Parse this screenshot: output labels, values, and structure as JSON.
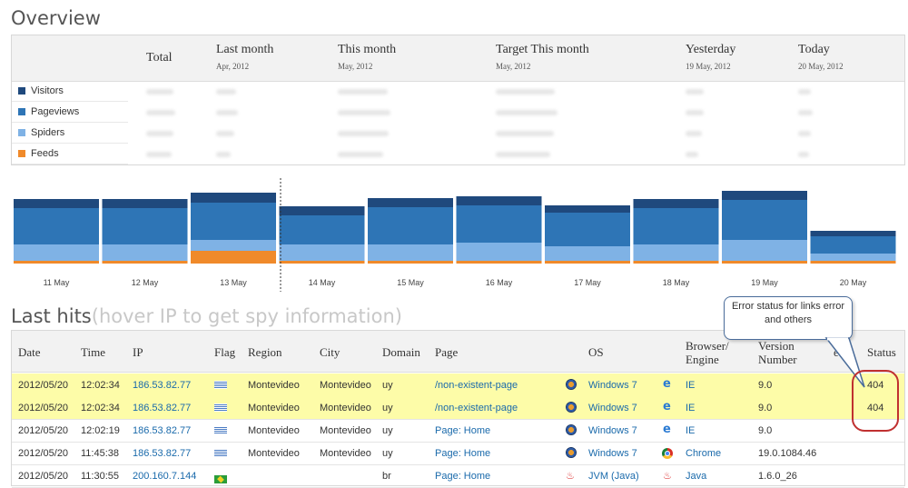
{
  "overview": {
    "title": "Overview",
    "columns": [
      {
        "label": "Total",
        "sub": ""
      },
      {
        "label": "Last month",
        "sub": "Apr, 2012"
      },
      {
        "label": "This month",
        "sub": "May, 2012"
      },
      {
        "label": "Target This month",
        "sub": "May, 2012"
      },
      {
        "label": "Yesterday",
        "sub": "19 May, 2012"
      },
      {
        "label": "Today",
        "sub": "20 May, 2012"
      }
    ],
    "rows": [
      {
        "label": "Visitors",
        "color": "#1f497d"
      },
      {
        "label": "Pageviews",
        "color": "#2e75b6"
      },
      {
        "label": "Spiders",
        "color": "#7fb2e5"
      },
      {
        "label": "Feeds",
        "color": "#f08a2a"
      }
    ]
  },
  "chart_data": {
    "type": "bar",
    "categories": [
      "11 May",
      "12 May",
      "13 May",
      "14 May",
      "15 May",
      "16 May",
      "17 May",
      "18 May",
      "19 May",
      "20 May"
    ],
    "series": [
      {
        "name": "Feeds",
        "values": [
          3,
          3,
          14,
          3,
          3,
          3,
          3,
          3,
          3,
          3
        ]
      },
      {
        "name": "Spiders",
        "values": [
          18,
          18,
          12,
          18,
          18,
          20,
          16,
          18,
          23,
          8
        ]
      },
      {
        "name": "Pageviews",
        "values": [
          40,
          40,
          41,
          32,
          41,
          41,
          37,
          40,
          44,
          19
        ]
      },
      {
        "name": "Visitors",
        "values": [
          10,
          10,
          11,
          10,
          10,
          10,
          8,
          10,
          10,
          6
        ]
      }
    ],
    "colors": [
      "#f08a2a",
      "#7fb2e5",
      "#2e75b6",
      "#1f497d"
    ],
    "title": "",
    "xlabel": "",
    "ylabel": ""
  },
  "hits": {
    "title": "Last hits",
    "hint": "(hover IP to get spy information)",
    "headers": [
      "Date",
      "Time",
      "IP",
      "Flag",
      "Region",
      "City",
      "Domain",
      "Page",
      "OS",
      "Browser/\nEngine",
      "Version\nNumber",
      "eed",
      "Status"
    ],
    "rows": [
      {
        "date": "2012/05/20",
        "time": "12:02:34",
        "ip": "186.53.82.77",
        "flag": "uy",
        "region": "Montevideo",
        "city": "Montevideo",
        "domain": "uy",
        "page": "/non-existent-page",
        "os_icon": "windows-icon",
        "os": "Windows 7",
        "browser_icon": "ie-icon",
        "browser": "IE",
        "version": "9.0",
        "status": "404",
        "highlight": true
      },
      {
        "date": "2012/05/20",
        "time": "12:02:34",
        "ip": "186.53.82.77",
        "flag": "uy",
        "region": "Montevideo",
        "city": "Montevideo",
        "domain": "uy",
        "page": "/non-existent-page",
        "os_icon": "windows-icon",
        "os": "Windows 7",
        "browser_icon": "ie-icon",
        "browser": "IE",
        "version": "9.0",
        "status": "404",
        "highlight": true
      },
      {
        "date": "2012/05/20",
        "time": "12:02:19",
        "ip": "186.53.82.77",
        "flag": "uy",
        "region": "Montevideo",
        "city": "Montevideo",
        "domain": "uy",
        "page": "Page: Home",
        "os_icon": "windows-icon",
        "os": "Windows 7",
        "browser_icon": "ie-icon",
        "browser": "IE",
        "version": "9.0",
        "status": "",
        "highlight": false
      },
      {
        "date": "2012/05/20",
        "time": "11:45:38",
        "ip": "186.53.82.77",
        "flag": "uy",
        "region": "Montevideo",
        "city": "Montevideo",
        "domain": "uy",
        "page": "Page: Home",
        "os_icon": "windows-icon",
        "os": "Windows 7",
        "browser_icon": "chrome-icon",
        "browser": "Chrome",
        "version": "19.0.1084.46",
        "status": "",
        "highlight": false
      },
      {
        "date": "2012/05/20",
        "time": "11:30:55",
        "ip": "200.160.7.144",
        "flag": "br",
        "region": "",
        "city": "",
        "domain": "br",
        "page": "Page: Home",
        "os_icon": "java-icon",
        "os": "JVM (Java)",
        "browser_icon": "java-icon",
        "browser": "Java",
        "version": "1.6.0_26",
        "status": "",
        "highlight": false
      }
    ]
  },
  "callout": {
    "text": "Error status for links error and others"
  }
}
